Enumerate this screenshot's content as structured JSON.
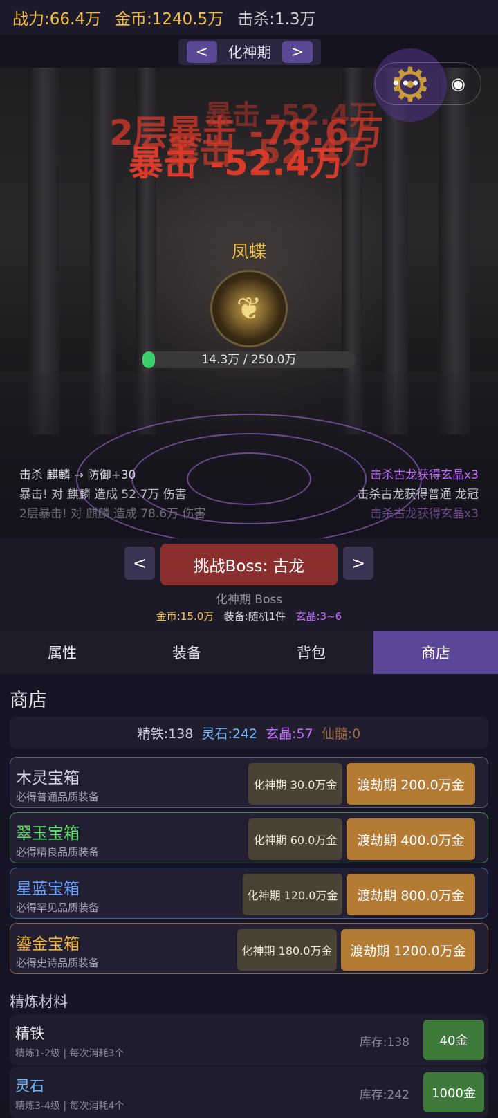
{
  "stats": {
    "power": "战力:66.4万",
    "gold": "金币:1240.5万",
    "kills": "击杀:1.3万"
  },
  "stage": {
    "prev": "<",
    "name": "化神期",
    "next": ">"
  },
  "capsule": {
    "more": "•••",
    "target": "◉"
  },
  "damage": {
    "line1": "2层暴击 -78.6万",
    "line2": "暴击 -52.4万",
    "line3": "暴击 -52.4万",
    "ghost": "暴击 -52.4万"
  },
  "boss": {
    "name": "凤蝶",
    "hp_text": "14.3万 / 250.0万",
    "hp_fraction": 0.057
  },
  "logs_left": [
    "击杀 麒麟 → 防御+30",
    "暴击! 对 麒麟 造成 52.7万 伤害",
    "2层暴击! 对 麒麟 造成 78.6万 伤害"
  ],
  "logs_right": [
    "击杀古龙获得玄晶x3",
    "击杀古龙获得普通 龙冠",
    "击杀古龙获得玄晶x3"
  ],
  "challenge": {
    "prev": "<",
    "label": "挑战Boss: 古龙",
    "next": ">",
    "sub": "化神期 Boss",
    "reward_gold": "金币:15.0万",
    "reward_equip": "装备:随机1件",
    "reward_crystal": "玄晶:3~6"
  },
  "tabs": [
    "属性",
    "装备",
    "背包",
    "商店"
  ],
  "shop": {
    "title": "商店",
    "res_iron": "精铁:138",
    "res_stone": "灵石:242",
    "res_crystal": "玄晶:57",
    "res_marrow": "仙髓:0",
    "chests": [
      {
        "name": "木灵宝箱",
        "desc": "必得普通品质装备",
        "small": "化神期 30.0万金",
        "big": "渡劫期 200.0万金",
        "color": "#d8d6e4",
        "border": "#5f5a78"
      },
      {
        "name": "翠玉宝箱",
        "desc": "必得精良品质装备",
        "small": "化神期 60.0万金",
        "big": "渡劫期 400.0万金",
        "color": "#5fe06a",
        "border": "#3f8a4a"
      },
      {
        "name": "星蓝宝箱",
        "desc": "必得罕见品质装备",
        "small": "化神期 120.0万金",
        "big": "渡劫期 800.0万金",
        "color": "#6aa2ff",
        "border": "#3f5f9a"
      },
      {
        "name": "鎏金宝箱",
        "desc": "必得史诗品质装备",
        "small": "化神期 180.0万金",
        "big": "渡劫期 1200.0万金",
        "color": "#f0b43a",
        "border": "#8a6a3a"
      }
    ],
    "refine_title": "精炼材料",
    "materials": [
      {
        "name": "精铁",
        "desc": "精炼1-2级 | 每次消耗3个",
        "stock": "库存:138",
        "price": "40金",
        "color": "#e5e3ee"
      },
      {
        "name": "灵石",
        "desc": "精炼3-4级 | 每次消耗4个",
        "stock": "库存:242",
        "price": "1000金",
        "color": "#6ab8ff"
      }
    ]
  }
}
